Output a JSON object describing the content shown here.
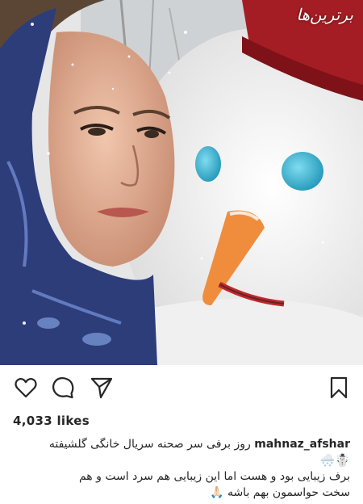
{
  "watermark": "برترین‌ها",
  "likes": "4,033 likes",
  "caption": {
    "username": "mahnaz_afshar",
    "line1": "روز برفی سر صحنه  سریال خانگی گلشیفته",
    "emoji_line": "☃️🌨️",
    "line3": "برف زیبایی بود و هست اما این زیبایی هم سرد است و هم",
    "line4": "سخت حواسمون بهم باشه 🙏🏻"
  },
  "icons": {
    "like": "heart-icon",
    "comment": "comment-icon",
    "share": "share-icon",
    "save": "bookmark-icon"
  },
  "colors": {
    "text": "#262626",
    "background": "#ffffff"
  }
}
